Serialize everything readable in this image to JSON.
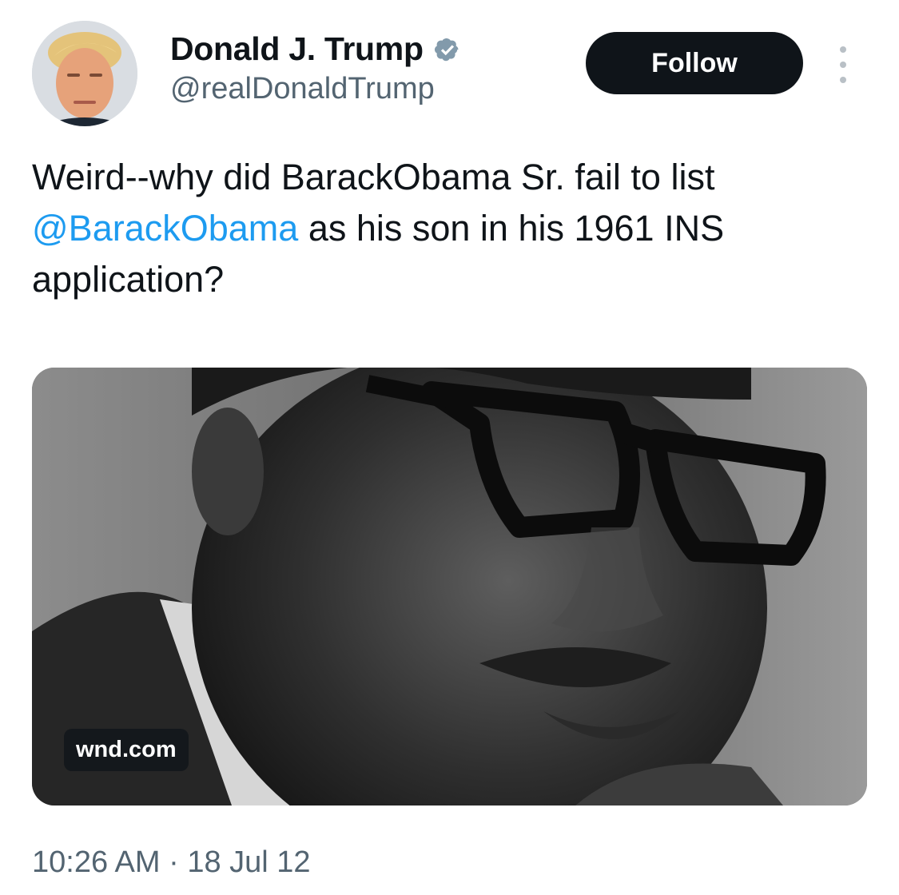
{
  "tweet": {
    "author": {
      "display_name": "Donald J. Trump",
      "handle": "@realDonaldTrump",
      "verified_icon": "verified-badge-icon",
      "avatar_icon": "profile-photo"
    },
    "follow_label": "Follow",
    "more_icon": "more-options-icon",
    "text": {
      "before": "Weird--why did BarackObama Sr. fail to list ",
      "mention": "@BarackObama",
      "after": " as his son in his 1961 INS application?"
    },
    "media": {
      "domain": "wnd.com",
      "image": "black-and-white portrait photo"
    },
    "timestamp": "10:26 AM · 18 Jul 12"
  },
  "colors": {
    "text": "#0f1419",
    "secondary": "#536471",
    "mention": "#1d9bf0",
    "verified": "#829aab",
    "follow_bg": "#0f1419"
  }
}
